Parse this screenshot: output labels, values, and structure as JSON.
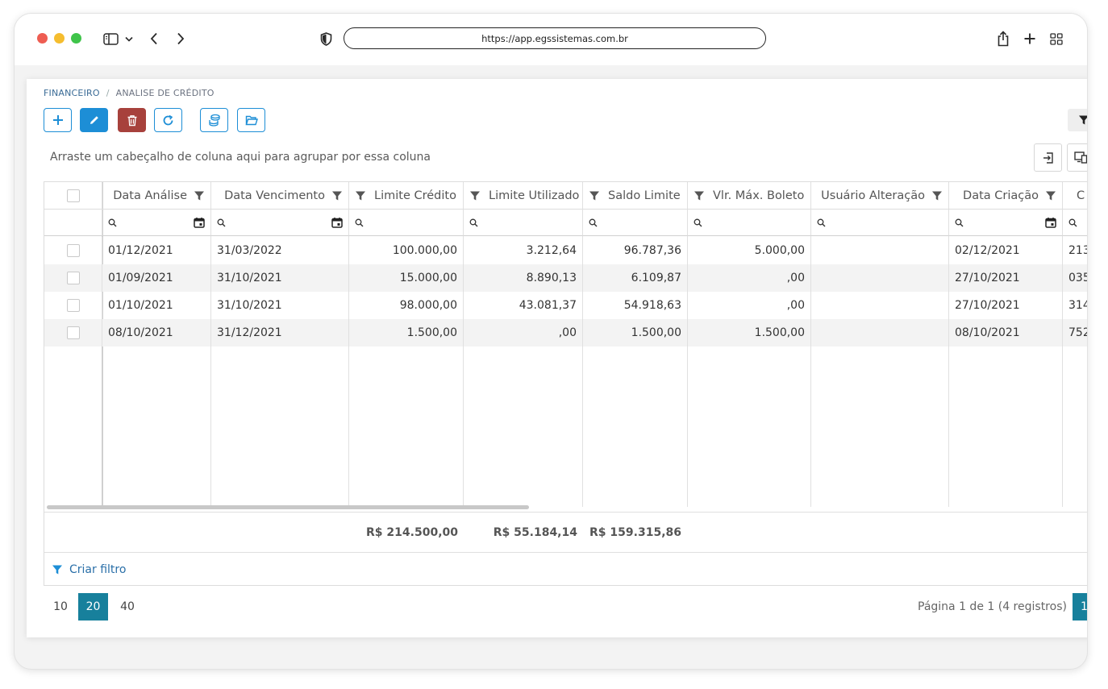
{
  "browser": {
    "url": "https://app.egssistemas.com.br"
  },
  "breadcrumb": {
    "parent": "FINANCEIRO",
    "separator": "/",
    "current": "ANALISE DE CRÉDITO"
  },
  "toolbar": {
    "buttons": [
      "add",
      "edit",
      "delete",
      "refresh",
      "credit-coins",
      "open-folder"
    ]
  },
  "group_hint": "Arraste um cabeçalho de coluna aqui para agrupar por essa coluna",
  "grid": {
    "columns": [
      "Data Análise",
      "Data Vencimento",
      "Limite Crédito",
      "Limite Utilizado",
      "Saldo Limite",
      "Vlr. Máx. Boleto",
      "Usuário Alteração",
      "Data Criação",
      "C"
    ],
    "rows": [
      [
        "01/12/2021",
        "31/03/2022",
        "100.000,00",
        "3.212,64",
        "96.787,36",
        "5.000,00",
        "",
        "02/12/2021",
        "213"
      ],
      [
        "01/09/2021",
        "31/10/2021",
        "15.000,00",
        "8.890,13",
        "6.109,87",
        ",00",
        "",
        "27/10/2021",
        "035"
      ],
      [
        "01/10/2021",
        "31/10/2021",
        "98.000,00",
        "43.081,37",
        "54.918,63",
        ",00",
        "",
        "27/10/2021",
        "314"
      ],
      [
        "08/10/2021",
        "31/12/2021",
        "1.500,00",
        ",00",
        "1.500,00",
        "1.500,00",
        "",
        "08/10/2021",
        "752"
      ]
    ],
    "totals": {
      "limite_credito": "R$ 214.500,00",
      "limite_utilizado": "R$ 55.184,14",
      "saldo_limite": "R$ 159.315,86"
    },
    "create_filter": "Criar filtro"
  },
  "pagination": {
    "sizes": [
      "10",
      "20",
      "40"
    ],
    "active_size": "20",
    "info": "Página 1 de 1 (4 registros)",
    "page": "1"
  },
  "colors": {
    "accent": "#1d8ed6",
    "danger": "#a7413c",
    "pager_active": "#17809c"
  }
}
